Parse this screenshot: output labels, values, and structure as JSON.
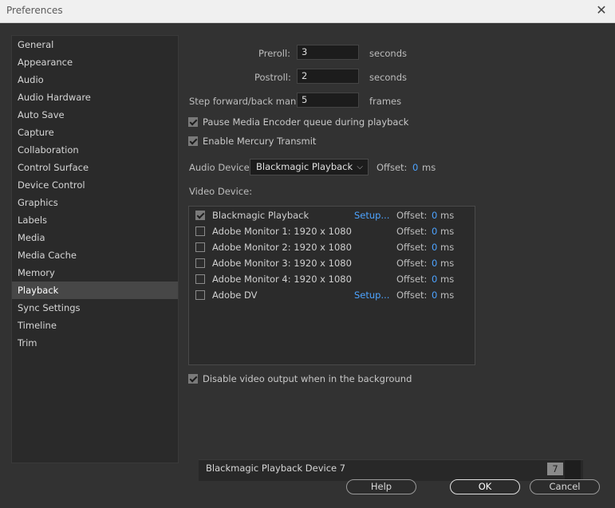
{
  "window": {
    "title": "Preferences"
  },
  "sidebar": {
    "items": [
      {
        "label": "General"
      },
      {
        "label": "Appearance"
      },
      {
        "label": "Audio"
      },
      {
        "label": "Audio Hardware"
      },
      {
        "label": "Auto Save"
      },
      {
        "label": "Capture"
      },
      {
        "label": "Collaboration"
      },
      {
        "label": "Control Surface"
      },
      {
        "label": "Device Control"
      },
      {
        "label": "Graphics"
      },
      {
        "label": "Labels"
      },
      {
        "label": "Media"
      },
      {
        "label": "Media Cache"
      },
      {
        "label": "Memory"
      },
      {
        "label": "Playback"
      },
      {
        "label": "Sync Settings"
      },
      {
        "label": "Timeline"
      },
      {
        "label": "Trim"
      }
    ],
    "selected": "Playback"
  },
  "playback": {
    "preroll": {
      "label": "Preroll:",
      "value": "3",
      "unit": "seconds"
    },
    "postroll": {
      "label": "Postroll:",
      "value": "2",
      "unit": "seconds"
    },
    "step": {
      "label": "Step forward/back many:",
      "value": "5",
      "unit": "frames"
    },
    "pause_encoder": {
      "label": "Pause Media Encoder queue during playback",
      "checked": true
    },
    "mercury": {
      "label": "Enable Mercury Transmit",
      "checked": true
    },
    "audio_device": {
      "label": "Audio Device:",
      "value": "Blackmagic Playback",
      "offset_label": "Offset:",
      "offset_value": "0",
      "offset_unit": "ms"
    },
    "video_device": {
      "label": "Video Device:",
      "rows": [
        {
          "name": "Blackmagic Playback",
          "checked": true,
          "setup": "Setup...",
          "offset_label": "Offset:",
          "offset_value": "0",
          "offset_unit": "ms"
        },
        {
          "name": "Adobe Monitor 1: 1920 x 1080",
          "checked": false,
          "setup": "",
          "offset_label": "Offset:",
          "offset_value": "0",
          "offset_unit": "ms"
        },
        {
          "name": "Adobe Monitor 2: 1920 x 1080",
          "checked": false,
          "setup": "",
          "offset_label": "Offset:",
          "offset_value": "0",
          "offset_unit": "ms"
        },
        {
          "name": "Adobe Monitor 3: 1920 x 1080",
          "checked": false,
          "setup": "",
          "offset_label": "Offset:",
          "offset_value": "0",
          "offset_unit": "ms"
        },
        {
          "name": "Adobe Monitor 4: 1920 x 1080",
          "checked": false,
          "setup": "",
          "offset_label": "Offset:",
          "offset_value": "0",
          "offset_unit": "ms"
        },
        {
          "name": "Adobe DV",
          "checked": false,
          "setup": "Setup...",
          "offset_label": "Offset:",
          "offset_value": "0",
          "offset_unit": "ms"
        }
      ]
    },
    "disable_bg": {
      "label": "Disable video output when in the background",
      "checked": true
    }
  },
  "device_bar": {
    "name": "Blackmagic Playback Device 7",
    "number": "7"
  },
  "buttons": {
    "help": "Help",
    "ok": "OK",
    "cancel": "Cancel"
  },
  "colors": {
    "accent": "#4da3ff",
    "background": "#323232"
  }
}
